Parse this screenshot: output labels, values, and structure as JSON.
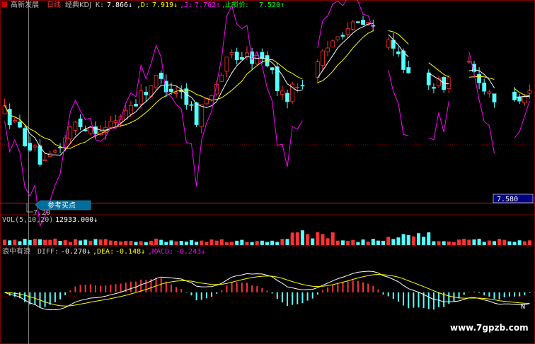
{
  "header": {
    "stock_name": "高新发展",
    "period": "日线",
    "indicator_name": "经典KDJ",
    "k_label": "K:",
    "k_value": "7.866↓",
    "d_label": ",D:",
    "d_value": "7.919↓",
    "j_label": ",J:",
    "j_value": "7.762↑",
    "stop_label": ",止损价:",
    "stop_value": "7.520↑"
  },
  "price_panel": {
    "price_tag": "7.580",
    "low_label": "7.20",
    "buy_point_label": "参考买点"
  },
  "vol_panel": {
    "label": "VOL(5,10,20)",
    "value": "12933.000↓"
  },
  "macd_panel": {
    "label": "浪中有浪",
    "diff_label": "DIFF:",
    "diff_value": "-0.270↓",
    "dea_label": ",DEA:",
    "dea_value": "-0.148↓",
    "macd_label": ",MACD:",
    "macd_value": "-0.243↓",
    "end_label": "N"
  },
  "watermark": "www.7gpzb.com",
  "colors": {
    "up": "#ff3232",
    "down": "#54ffff",
    "ma_white": "#ffffff",
    "ma_yellow": "#ffff00",
    "kdj_magenta": "#ff00ff",
    "grid": "#800000",
    "tag_bg": "#000080",
    "buy_bg": "#006d9a"
  },
  "chart_data": {
    "type": "candlestick",
    "sessions": 105,
    "price_axis_ylim": [
      6.8,
      9.8
    ],
    "vol_axis_ylim": [
      0,
      60000
    ],
    "macd_axis_ylim": [
      -0.6,
      0.45
    ],
    "current_price": 7.58,
    "marked_low": 7.2,
    "last_vol": 12933,
    "last_diff": -0.27,
    "last_dea": -0.148,
    "last_macd": -0.243,
    "last_k": 7.866,
    "last_d": 7.919,
    "last_j": 7.762,
    "stop_price": 7.52
  }
}
